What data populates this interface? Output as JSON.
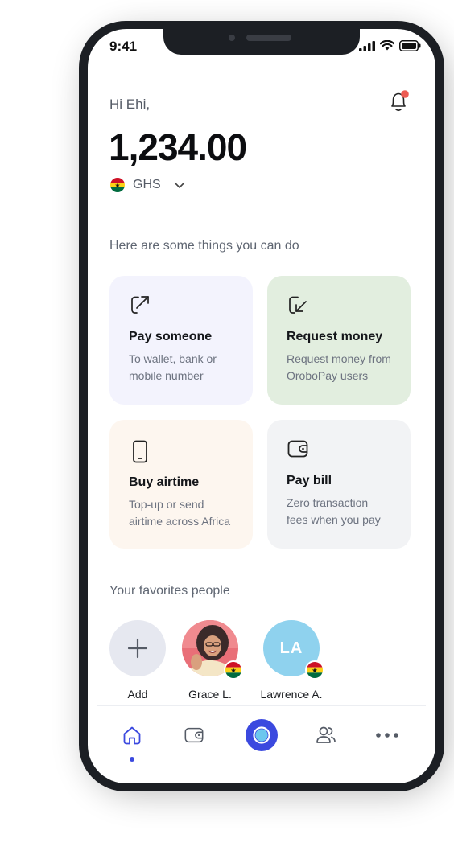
{
  "status_bar": {
    "time": "9:41"
  },
  "header": {
    "greeting": "Hi Ehi,",
    "balance": "1,234.00",
    "currency": "GHS"
  },
  "actions": {
    "label": "Here are some things you can do",
    "items": [
      {
        "title": "Pay someone",
        "desc": "To wallet, bank or mobile number",
        "icon": "arrow-out-icon",
        "bg": "#f3f3fd"
      },
      {
        "title": "Request money",
        "desc": "Request money from OroboPay users",
        "icon": "arrow-in-icon",
        "bg": "#e2eedf"
      },
      {
        "title": "Buy airtime",
        "desc": "Top-up or send airtime across Africa",
        "icon": "phone-icon",
        "bg": "#fdf6ef"
      },
      {
        "title": "Pay bill",
        "desc": "Zero transaction fees when you pay",
        "icon": "wallet-icon",
        "bg": "#f2f3f5"
      }
    ]
  },
  "favorites": {
    "label": "Your favorites people",
    "people": [
      {
        "name": "Add",
        "type": "add-button"
      },
      {
        "name": "Grace L.",
        "type": "photo"
      },
      {
        "name": "Lawrence A.",
        "initials": "LA",
        "type": "initials",
        "color": "#8fd2ee"
      }
    ]
  },
  "nav": {
    "items": [
      "home-icon",
      "wallet-icon",
      "scan-icon",
      "people-icon",
      "more-icon"
    ],
    "active": "home-icon",
    "accent": "#3b49df"
  }
}
